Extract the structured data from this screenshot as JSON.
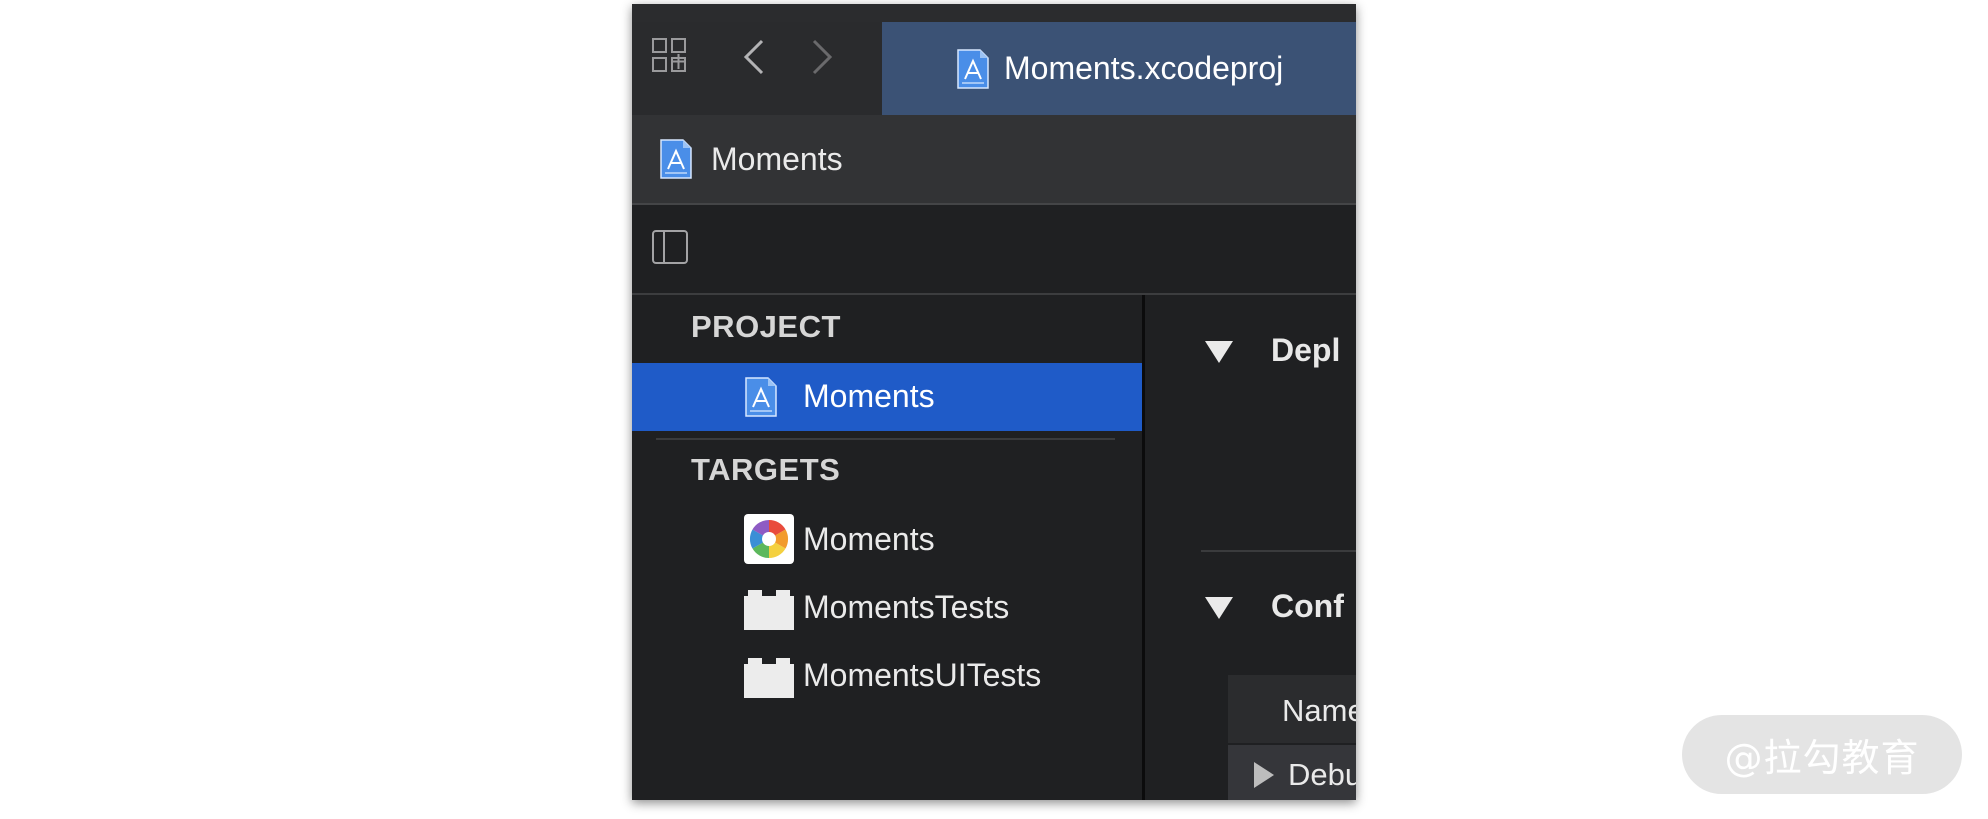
{
  "tab_bar": {
    "grid_icon": "grid-icon",
    "back_icon": "chevron-left-icon",
    "forward_icon": "chevron-right-icon",
    "active_tab": {
      "label": "Moments.xcodeproj",
      "icon": "xcodeproj-file-icon"
    }
  },
  "jump_bar": {
    "label": "Moments",
    "icon": "xcodeproj-file-icon"
  },
  "editor_toolbar": {
    "sidebar_toggle_icon": "sidebar-toggle-icon"
  },
  "sidebar": {
    "project_header": "PROJECT",
    "project_items": [
      {
        "label": "Moments",
        "icon": "xcodeproj-file-icon",
        "selected": true
      }
    ],
    "targets_header": "TARGETS",
    "target_items": [
      {
        "label": "Moments",
        "icon": "app-target-icon"
      },
      {
        "label": "MomentsTests",
        "icon": "test-bundle-icon"
      },
      {
        "label": "MomentsUITests",
        "icon": "test-bundle-icon"
      }
    ]
  },
  "content": {
    "sections": [
      {
        "title": "Depl",
        "expanded": true
      },
      {
        "title": "Conf",
        "expanded": true
      }
    ],
    "table": {
      "header": "Name",
      "rows": [
        {
          "label": "Debu",
          "expanded": false
        }
      ]
    }
  },
  "colors": {
    "selection": "#1f5bc8",
    "active_tab": "#3b5275",
    "window_background": "#1f2022"
  },
  "watermark": "@拉勾教育"
}
